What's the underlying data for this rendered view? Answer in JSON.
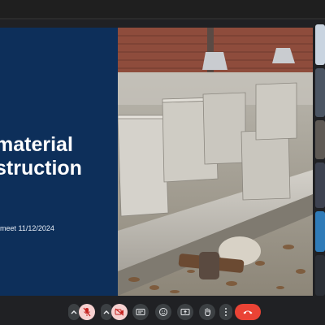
{
  "slide": {
    "title_line1": "material",
    "title_line2": "struction",
    "subtitle": "meet 11/12/2024"
  },
  "icons": {
    "mic": "mic-off-icon",
    "camera": "camera-off-icon",
    "captions": "captions-icon",
    "emoji": "emoji-icon",
    "present": "present-screen-icon",
    "raise_hand": "raise-hand-icon",
    "more": "more-options-icon",
    "end_call": "end-call-icon",
    "chevron": "chevron-up-icon"
  },
  "colors": {
    "slide_bg": "#0d2f5a",
    "end_call": "#ea4335",
    "muted_button": "#f6d1d0",
    "toolbar_bg": "#202124"
  }
}
